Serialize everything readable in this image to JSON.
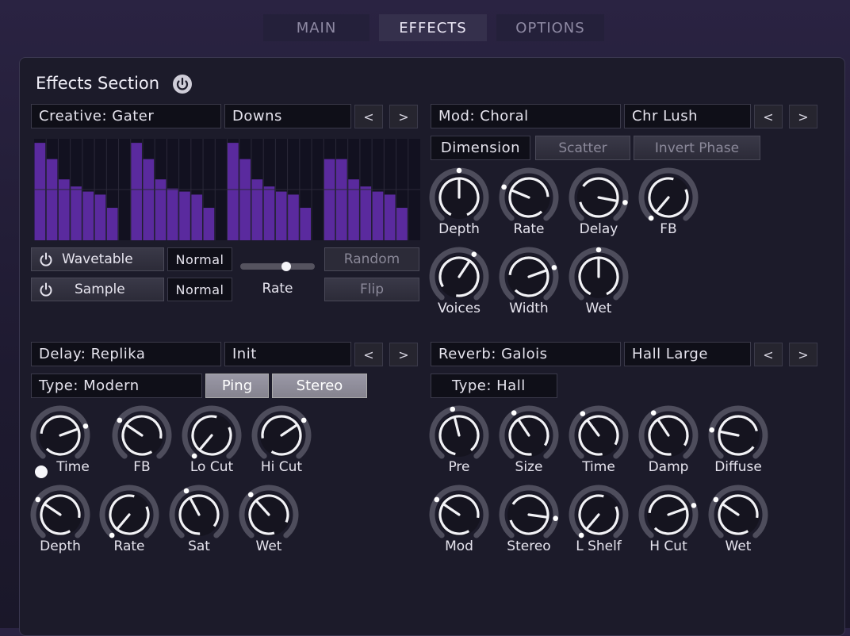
{
  "tabs": [
    {
      "label": "MAIN",
      "active": false
    },
    {
      "label": "EFFECTS",
      "active": true
    },
    {
      "label": "OPTIONS",
      "active": false
    }
  ],
  "section_title": "Effects Section",
  "arrows": {
    "prev": "<",
    "next": ">"
  },
  "gater": {
    "module": "Creative: Gater",
    "preset": "Downs",
    "steps": [
      0.96,
      0.8,
      0.6,
      0.53,
      0.48,
      0.45,
      0.32,
      0.0,
      0.96,
      0.8,
      0.6,
      0.51,
      0.48,
      0.45,
      0.32,
      0.0,
      0.96,
      0.8,
      0.6,
      0.53,
      0.48,
      0.45,
      0.32,
      0.0,
      0.8,
      0.8,
      0.6,
      0.53,
      0.48,
      0.45,
      0.32,
      0.0
    ],
    "bar_color": "#5a2a9e",
    "wavetable_label": "Wavetable",
    "wavetable_mode": "Normal",
    "sample_label": "Sample",
    "sample_mode": "Normal",
    "rate_label": "Rate",
    "rate_value": 0.62,
    "random_label": "Random",
    "flip_label": "Flip"
  },
  "chorus": {
    "module": "Mod: Choral",
    "preset": "Chr Lush",
    "buttons": [
      "Dimension",
      "Scatter",
      "Invert Phase"
    ],
    "knobs": [
      {
        "label": "Depth",
        "value": 0.5
      },
      {
        "label": "Rate",
        "value": 0.26
      },
      {
        "label": "Delay",
        "value": 0.86
      },
      {
        "label": "FB",
        "value": 0.0
      },
      {
        "label": "Voices",
        "value": 0.62
      },
      {
        "label": "Width",
        "value": 0.75
      },
      {
        "label": "Wet",
        "value": 0.5
      }
    ]
  },
  "delay": {
    "module": "Delay: Replika",
    "preset": "Init",
    "type_label": "Type: Modern",
    "ping_label": "Ping",
    "stereo_label": "Stereo",
    "knobs": [
      {
        "label": "Time",
        "value": 0.75
      },
      {
        "label": "FB",
        "value": 0.3
      },
      {
        "label": "Lo Cut",
        "value": 0.0
      },
      {
        "label": "Hi Cut",
        "value": 0.7
      },
      {
        "label": "Depth",
        "value": 0.3
      },
      {
        "label": "Rate",
        "value": 0.0
      },
      {
        "label": "Sat",
        "value": 0.4
      },
      {
        "label": "Wet",
        "value": 0.35
      }
    ]
  },
  "reverb": {
    "module": "Reverb: Galois",
    "preset": "Hall Large",
    "type_label": "Type: Hall",
    "knobs": [
      {
        "label": "Pre",
        "value": 0.45
      },
      {
        "label": "Size",
        "value": 0.38
      },
      {
        "label": "Time",
        "value": 0.37
      },
      {
        "label": "Damp",
        "value": 0.38
      },
      {
        "label": "Diffuse",
        "value": 0.22
      },
      {
        "label": "Mod",
        "value": 0.3
      },
      {
        "label": "Stereo",
        "value": 0.85
      },
      {
        "label": "L Shelf",
        "value": 0.0
      },
      {
        "label": "H Cut",
        "value": 0.75
      },
      {
        "label": "Wet",
        "value": 0.3
      }
    ]
  }
}
